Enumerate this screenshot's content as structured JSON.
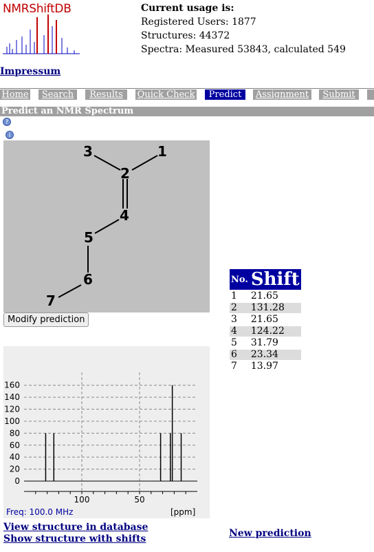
{
  "header": {
    "logo_text": "NMRShiftDB",
    "usage_heading": "Current usage is:",
    "registered_users": "Registered Users: 1877",
    "structures": "Structures: 44372",
    "spectra": "Spectra: Measured 53843, calculated 549",
    "impressum": "Impressum"
  },
  "tabs": [
    {
      "label": "Home",
      "active": false
    },
    {
      "label": "Search",
      "active": false
    },
    {
      "label": "Results",
      "active": false
    },
    {
      "label": "Quick Check",
      "active": false
    },
    {
      "label": "Predict",
      "active": true
    },
    {
      "label": "Assignment",
      "active": false
    },
    {
      "label": "Submit",
      "active": false
    }
  ],
  "section_title": "Predict an NMR Spectrum",
  "molecule": {
    "atoms": [
      "1",
      "2",
      "3",
      "4",
      "5",
      "6",
      "7"
    ],
    "bonds": [
      [
        "3",
        "2",
        1
      ],
      [
        "1",
        "2",
        1
      ],
      [
        "2",
        "4",
        2
      ],
      [
        "4",
        "5",
        1
      ],
      [
        "5",
        "6",
        1
      ],
      [
        "6",
        "7",
        1
      ]
    ]
  },
  "modify_button": "Modify prediction",
  "shift_table": {
    "headers": [
      "No.",
      "Shift"
    ],
    "rows": [
      {
        "no": "1",
        "shift": "21.65"
      },
      {
        "no": "2",
        "shift": "131.28"
      },
      {
        "no": "3",
        "shift": "21.65"
      },
      {
        "no": "4",
        "shift": "124.22"
      },
      {
        "no": "5",
        "shift": "31.79"
      },
      {
        "no": "6",
        "shift": "23.34"
      },
      {
        "no": "7",
        "shift": "13.97"
      }
    ]
  },
  "chart_data": {
    "type": "bar",
    "x": [
      131.28,
      124.22,
      31.79,
      23.34,
      21.65,
      13.97
    ],
    "values": [
      80,
      80,
      80,
      80,
      160,
      80
    ],
    "yticks": [
      0,
      20,
      40,
      60,
      80,
      100,
      120,
      140,
      160
    ],
    "xticks": [
      100,
      50
    ],
    "xlim": [
      150,
      0
    ],
    "ylim": [
      0,
      170
    ],
    "freq_label": "Freq: 100.0 MHz",
    "unit_label": "[ppm]",
    "grid": true
  },
  "links": {
    "view_db": "View structure in database",
    "show_shifts": "Show structure with shifts",
    "new_prediction": "New prediction"
  },
  "colors": {
    "accent": "#0000a0",
    "tab_bg": "#a0a0a0",
    "logo_red": "#c00000",
    "logo_blue": "#0000c0"
  }
}
